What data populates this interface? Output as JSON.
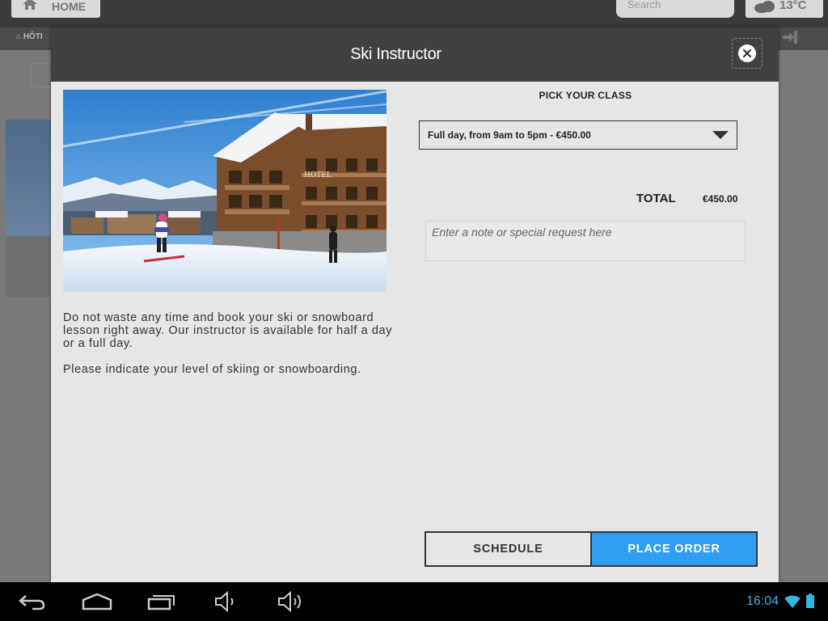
{
  "background": {
    "home_label": "HOME",
    "search_placeholder": "Search",
    "weather": "13°C",
    "crumb": "HÔTI"
  },
  "modal": {
    "title": "Ski Instructor",
    "description": [
      "Do not waste any time and book your ski or snowboard lesson right away. Our instructor is available for half a day or a full day.",
      "Please indicate your level of skiing or snowboarding."
    ],
    "hero_image_alt": "",
    "hotel_sign": "HOTEL",
    "pick_class_title": "PICK YOUR CLASS",
    "selected_class": "Full day, from 9am to 5pm - €450.00",
    "total_label": "TOTAL",
    "total_value": "€450.00",
    "note_placeholder": "Enter a note or special request here",
    "schedule_label": "SCHEDULE",
    "place_order_label": "PLACE ORDER"
  },
  "system_bar": {
    "time": "16:04"
  },
  "colors": {
    "accent": "#2f9ef0",
    "header": "#414141",
    "modal_bg": "#e6e6e6",
    "clock": "#33b5e5"
  }
}
